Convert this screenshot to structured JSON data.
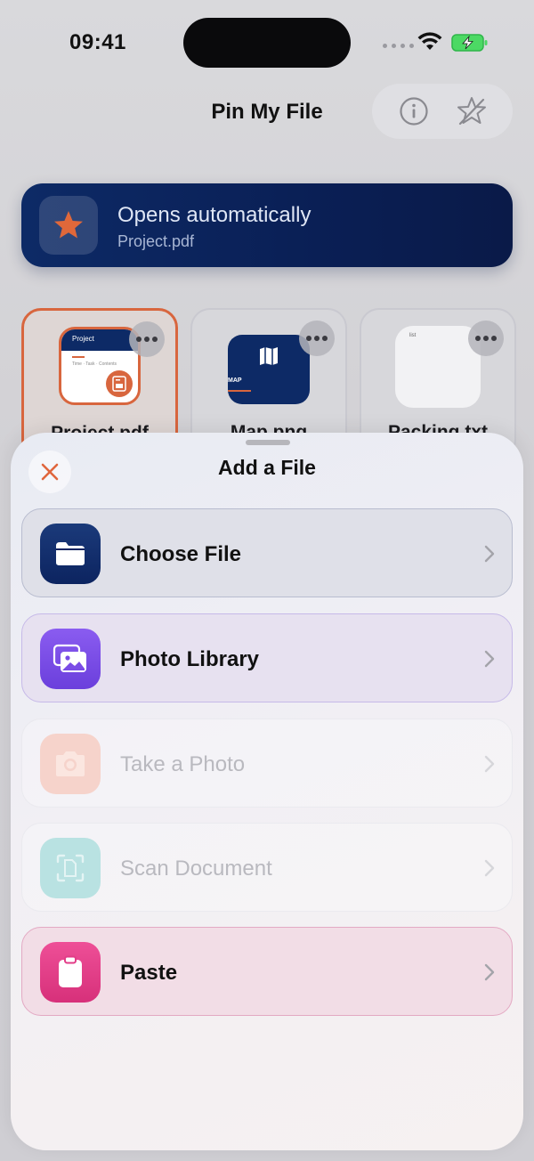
{
  "status_bar": {
    "time": "09:41"
  },
  "nav": {
    "title": "Pin My File",
    "info_icon": "info-icon",
    "pin_icon": "pin-star-icon"
  },
  "banner": {
    "title": "Opens automatically",
    "subtitle": "Project.pdf",
    "icon": "star-icon"
  },
  "files": [
    {
      "name": "Project.pdf",
      "thumb_title": "Project",
      "thumb_text": "Time · Task · Contents",
      "selected": true
    },
    {
      "name": "Map.png",
      "thumb_label": "MAP",
      "selected": false
    },
    {
      "name": "Packing.txt",
      "thumb_text": "list",
      "selected": false
    }
  ],
  "sheet": {
    "title": "Add a File",
    "options": [
      {
        "label": "Choose File",
        "icon": "folder-icon",
        "enabled": true
      },
      {
        "label": "Photo Library",
        "icon": "photos-icon",
        "enabled": true
      },
      {
        "label": "Take a Photo",
        "icon": "camera-icon",
        "enabled": false
      },
      {
        "label": "Scan Document",
        "icon": "scan-document-icon",
        "enabled": false
      },
      {
        "label": "Paste",
        "icon": "clipboard-icon",
        "enabled": true
      }
    ]
  },
  "colors": {
    "accent": "#d8663e",
    "navy": "#0d2a66",
    "photo_purple": "#7a4ce6",
    "paste_pink": "#e23c88"
  }
}
